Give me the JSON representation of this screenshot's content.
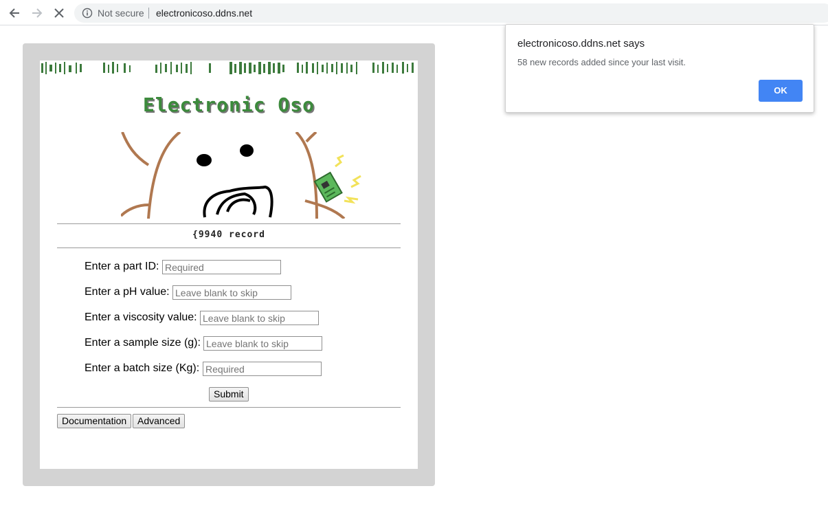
{
  "browser": {
    "security_label": "Not secure",
    "url": "electronicoso.ddns.net"
  },
  "site": {
    "title": "Electronic Oso",
    "record_count_text": "{9940 record"
  },
  "form": {
    "fields": [
      {
        "label": "Enter a part ID:",
        "placeholder": "Required"
      },
      {
        "label": "Enter a pH value:",
        "placeholder": "Leave blank to skip"
      },
      {
        "label": "Enter a viscosity value:",
        "placeholder": "Leave blank to skip"
      },
      {
        "label": "Enter a sample size (g):",
        "placeholder": "Leave blank to skip"
      },
      {
        "label": "Enter a batch size (Kg):",
        "placeholder": "Required"
      }
    ],
    "submit_label": "Submit"
  },
  "footer_buttons": {
    "documentation_label": "Documentation",
    "advanced_label": "Advanced"
  },
  "dialog": {
    "title": "electronicoso.ddns.net says",
    "message": "58 new records added since your last visit.",
    "ok_label": "OK"
  },
  "colors": {
    "title_green": "#3c8a3c",
    "frame_gray": "#d3d3d3",
    "ok_blue": "#4285f4"
  }
}
